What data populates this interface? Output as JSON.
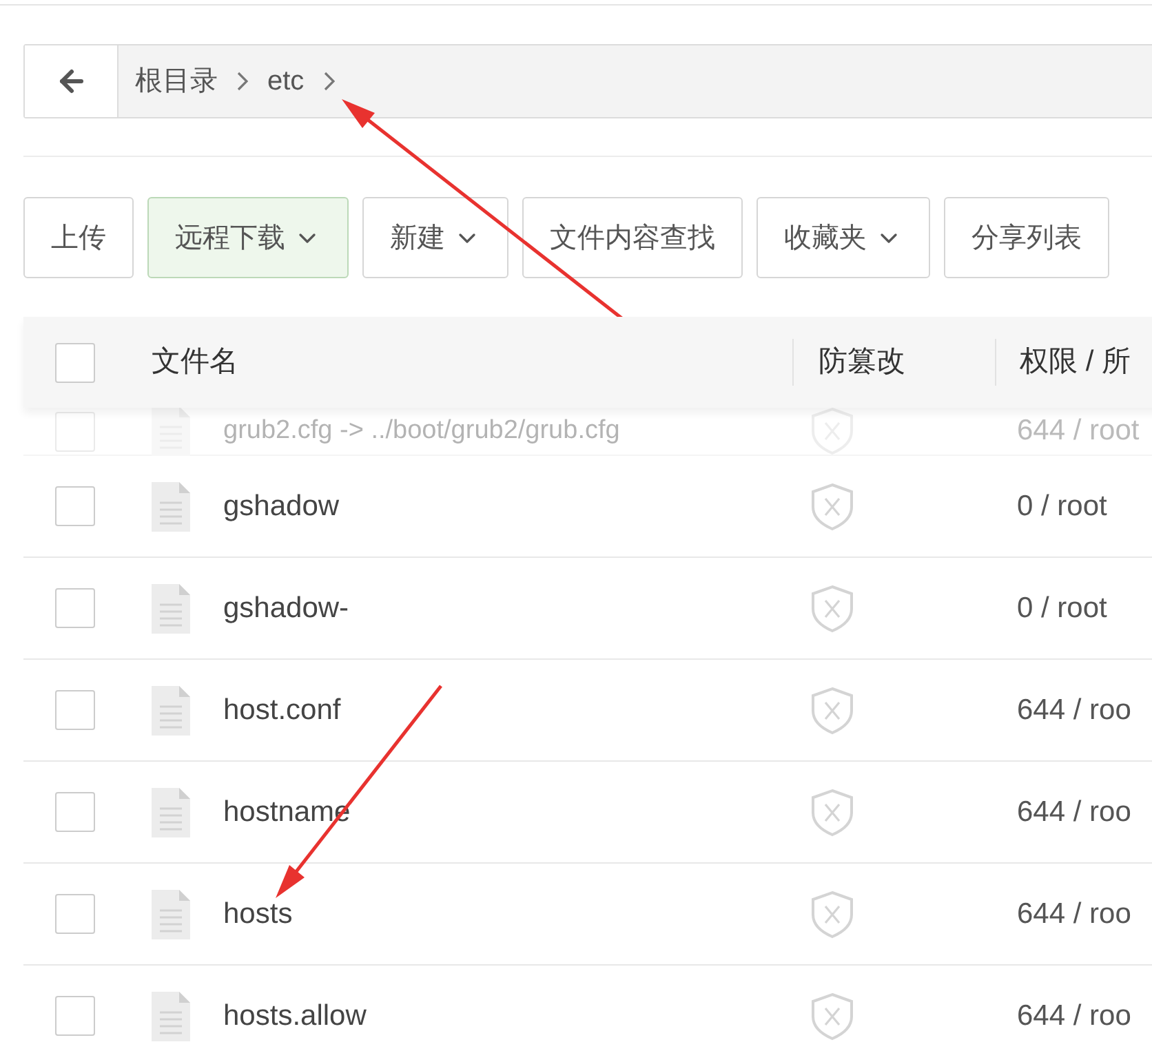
{
  "breadcrumb": [
    "根目录",
    "etc"
  ],
  "toolbar": [
    {
      "label": "上传",
      "dropdown": false,
      "active": false
    },
    {
      "label": "远程下载",
      "dropdown": true,
      "active": true
    },
    {
      "label": "新建",
      "dropdown": true,
      "active": false
    },
    {
      "label": "文件内容查找",
      "dropdown": false,
      "active": false
    },
    {
      "label": "收藏夹",
      "dropdown": true,
      "active": false
    },
    {
      "label": "分享列表",
      "dropdown": false,
      "active": false
    }
  ],
  "table": {
    "header_checked": false,
    "columns": [
      "文件名",
      "防篡改",
      "权限 / 所"
    ],
    "rows": [
      {
        "name": "grub2.cfg -> ../boot/grub2/grub.cfg",
        "permissions": "644 / root",
        "checked": false,
        "faded": true
      },
      {
        "name": "gshadow",
        "permissions": "0 / root",
        "checked": false,
        "faded": false
      },
      {
        "name": "gshadow-",
        "permissions": "0 / root",
        "checked": false,
        "faded": false
      },
      {
        "name": "host.conf",
        "permissions": "644 / roo",
        "checked": false,
        "faded": false
      },
      {
        "name": "hostname",
        "permissions": "644 / roo",
        "checked": false,
        "faded": false
      },
      {
        "name": "hosts",
        "permissions": "644 / roo",
        "checked": false,
        "faded": false
      },
      {
        "name": "hosts.allow",
        "permissions": "644 / roo",
        "checked": false,
        "faded": false
      }
    ]
  }
}
